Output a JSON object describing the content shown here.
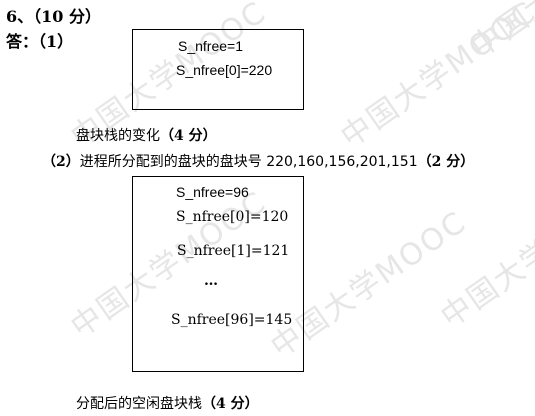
{
  "question": {
    "number": "6、",
    "score_open": "（",
    "score": "10 分",
    "score_close": "）"
  },
  "answer": {
    "label": "答：",
    "part1": "（1）"
  },
  "box1": {
    "lines": [
      "S_nfree=1",
      "S_nfree[0]=220"
    ]
  },
  "caption1": {
    "text": "盘块栈的变化",
    "score": "（4 分）"
  },
  "part2": {
    "label": "（2）",
    "text": "进程所分配到的盘块的盘块号 220,160,156,201,151",
    "score": "（2 分）"
  },
  "box2": {
    "lines": [
      "S_nfree=96",
      "S_nfree[0]=120",
      "S_nfree[1]=121",
      "…",
      "S_nfree[96]=145"
    ]
  },
  "caption2": {
    "text": "分配后的空闲盘块栈",
    "score": "（4 分）"
  },
  "watermark": "中国大学MOOC"
}
